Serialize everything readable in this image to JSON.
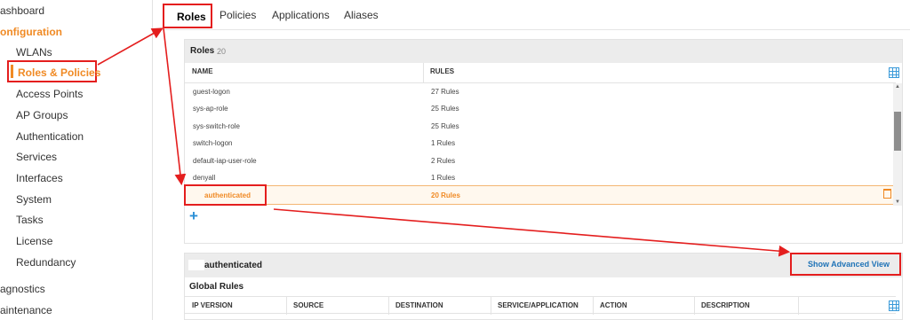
{
  "sidebar": {
    "top_items": [
      "ashboard",
      "onfiguration"
    ],
    "sub_items": [
      "WLANs",
      "Roles & Policies",
      "Access Points",
      "AP Groups",
      "Authentication",
      "Services",
      "Interfaces",
      "System",
      "Tasks",
      "License",
      "Redundancy"
    ],
    "bottom_items": [
      "agnostics",
      "aintenance"
    ],
    "selected_sub_item": "Roles & Policies"
  },
  "tabs": [
    "Roles",
    "Policies",
    "Applications",
    "Aliases"
  ],
  "active_tab": "Roles",
  "roles_panel": {
    "title": "Roles",
    "count": "20",
    "columns": [
      "NAME",
      "RULES"
    ],
    "rows": [
      {
        "name": "guest-logon",
        "rules": "27 Rules"
      },
      {
        "name": "sys-ap-role",
        "rules": "25 Rules"
      },
      {
        "name": "sys-switch-role",
        "rules": "25 Rules"
      },
      {
        "name": "switch-logon",
        "rules": "1 Rules"
      },
      {
        "name": "default-iap-user-role",
        "rules": "2 Rules"
      },
      {
        "name": "denyall",
        "rules": "1 Rules"
      },
      {
        "name": "authenticated",
        "rules": "20 Rules"
      }
    ],
    "selected_row": "authenticated",
    "add_symbol": "+"
  },
  "detail_panel": {
    "title": "authenticated",
    "advanced_link": "Show Advanced View",
    "section_title": "Global Rules",
    "columns": [
      "IP VERSION",
      "SOURCE",
      "DESTINATION",
      "SERVICE/APPLICATION",
      "ACTION",
      "DESCRIPTION"
    ]
  },
  "colors": {
    "accent": "#f08a24",
    "annotation": "#e41e1e",
    "link": "#1f73b7",
    "icon": "#3a9ad9"
  }
}
